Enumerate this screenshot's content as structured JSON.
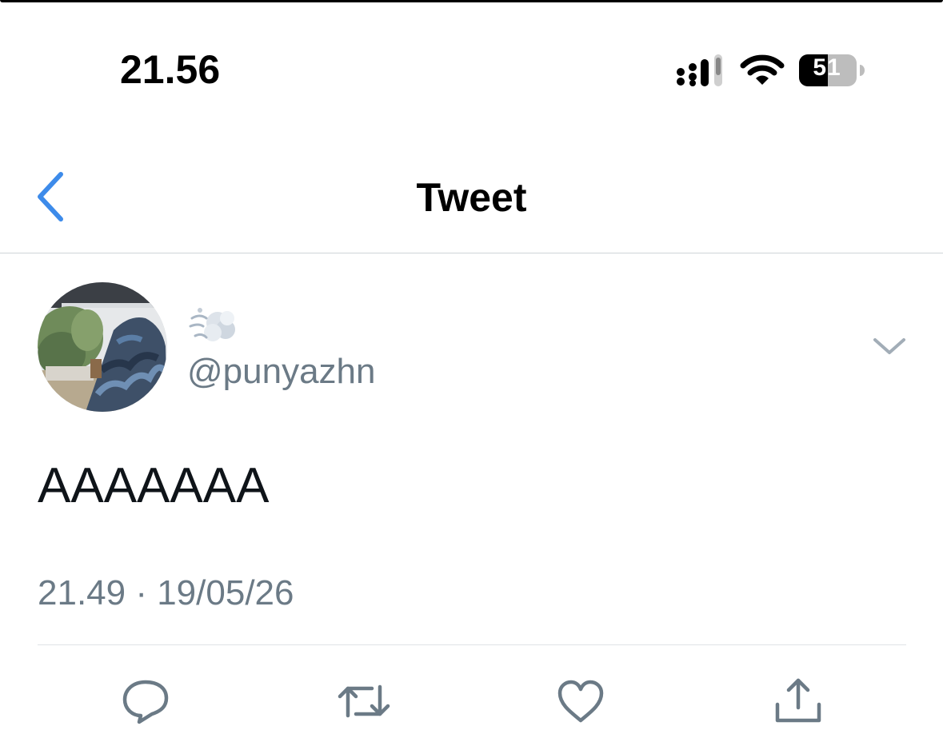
{
  "status_bar": {
    "time": "21.56",
    "battery_level": "51",
    "icons": [
      "signal-icon",
      "wifi-icon",
      "battery-icon"
    ]
  },
  "nav": {
    "title": "Tweet",
    "back_icon": "chevron-left-icon"
  },
  "tweet": {
    "display_name_emoji": "dashing-away-emoji",
    "handle": "@punyazhn",
    "text": "AAAAAAA",
    "timestamp": "21.49 · 19/05/26",
    "more_icon": "chevron-down-icon"
  },
  "actions": [
    {
      "name": "reply",
      "icon": "comment-icon"
    },
    {
      "name": "retweet",
      "icon": "retweet-icon"
    },
    {
      "name": "like",
      "icon": "heart-icon"
    },
    {
      "name": "share",
      "icon": "share-icon"
    }
  ],
  "colors": {
    "accent": "#3d8bea",
    "secondary_text": "#6b7a86",
    "divider": "#dfe3e6",
    "icon_gray": "#6b7a86"
  }
}
